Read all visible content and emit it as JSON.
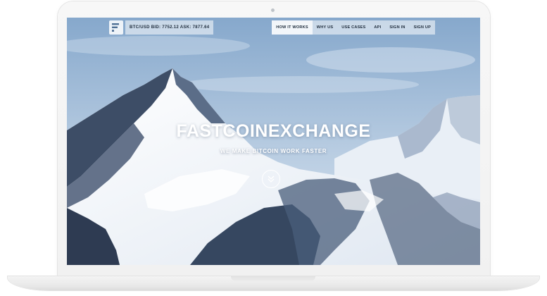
{
  "site": {
    "ticker": "BTC/USD BID: 7752.12 ASK: 7877.64",
    "nav": [
      "HOW IT WORKS",
      "WHY US",
      "USE CASES",
      "API",
      "SIGN IN",
      "SIGN UP"
    ],
    "active_nav": "HOW IT WORKS",
    "hero_title": "FASTCOINEXCHANGE",
    "hero_subtitle": "WE MAKE BITCOIN WORK FASTER",
    "scroll_icon": "chevron-double-down-icon",
    "logo_icon": "fastcoin-logo-icon"
  },
  "colors": {
    "sky_top": "#8fb0d2",
    "sky_bottom": "#cfdeec",
    "snow": "#f4f7fb",
    "rock": "#2b3a52",
    "nav_text": "#1f2d3d"
  }
}
